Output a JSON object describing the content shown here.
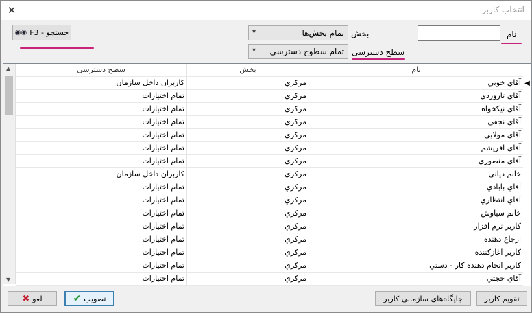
{
  "window": {
    "title": "انتخاب کاربر",
    "close_label": "✕"
  },
  "toolbar": {
    "search_label": "جستجو - F3"
  },
  "filters": {
    "name_label": "نام",
    "name_value": "",
    "section_label": "بخش",
    "section_value": "تمام بخش‌ها",
    "access_label": "سطح دسترسی",
    "access_value": "تمام سطوح دسترسی"
  },
  "table": {
    "columns": {
      "name": "نام",
      "section": "بخش",
      "access": "سطح دسترسی"
    },
    "rows": [
      {
        "name": "آقاي خوبي",
        "section": "مرکزي",
        "access": "کاربران داخل سازمان"
      },
      {
        "name": "آقاي تاروردي",
        "section": "مرکزي",
        "access": "تمام اختيارات"
      },
      {
        "name": "آقاي نيکخواه",
        "section": "مرکزي",
        "access": "تمام اختيارات"
      },
      {
        "name": "آقاي نجفي",
        "section": "مرکزي",
        "access": "تمام اختيارات"
      },
      {
        "name": "آقاي مولايي",
        "section": "مرکزي",
        "access": "تمام اختيارات"
      },
      {
        "name": "آقاي افريشم",
        "section": "مرکزي",
        "access": "تمام اختيارات"
      },
      {
        "name": "آقاي منصوري",
        "section": "مرکزي",
        "access": "تمام اختيارات"
      },
      {
        "name": "خانم دياني",
        "section": "مرکزي",
        "access": "کاربران داخل سازمان"
      },
      {
        "name": "آقاي بابادي",
        "section": "مرکزي",
        "access": "تمام اختيارات"
      },
      {
        "name": "آقاي انتظاري",
        "section": "مرکزي",
        "access": "تمام اختيارات"
      },
      {
        "name": "خانم سياوش",
        "section": "مرکزي",
        "access": "تمام اختيارات"
      },
      {
        "name": "کاربر نرم افزار",
        "section": "مرکزي",
        "access": "تمام اختيارات"
      },
      {
        "name": "ارجاع دهنده",
        "section": "مرکزي",
        "access": "تمام اختيارات"
      },
      {
        "name": "کاربر آغازکننده",
        "section": "مرکزي",
        "access": "تمام اختيارات"
      },
      {
        "name": "کاربر انجام دهنده کار - دستي",
        "section": "مرکزي",
        "access": "تمام اختيارات"
      },
      {
        "name": "آقاي حجتي",
        "section": "مرکزي",
        "access": "تمام اختيارات"
      }
    ]
  },
  "buttons": {
    "cancel": "لغو",
    "approve": "تصويب",
    "org_positions": "جايگاه‌هاي سازماني کاربر",
    "user_calendar": "تقويم کاربر"
  },
  "colors": {
    "ink_annotation": "#c8237a",
    "primary_border": "#3c7fb1"
  }
}
